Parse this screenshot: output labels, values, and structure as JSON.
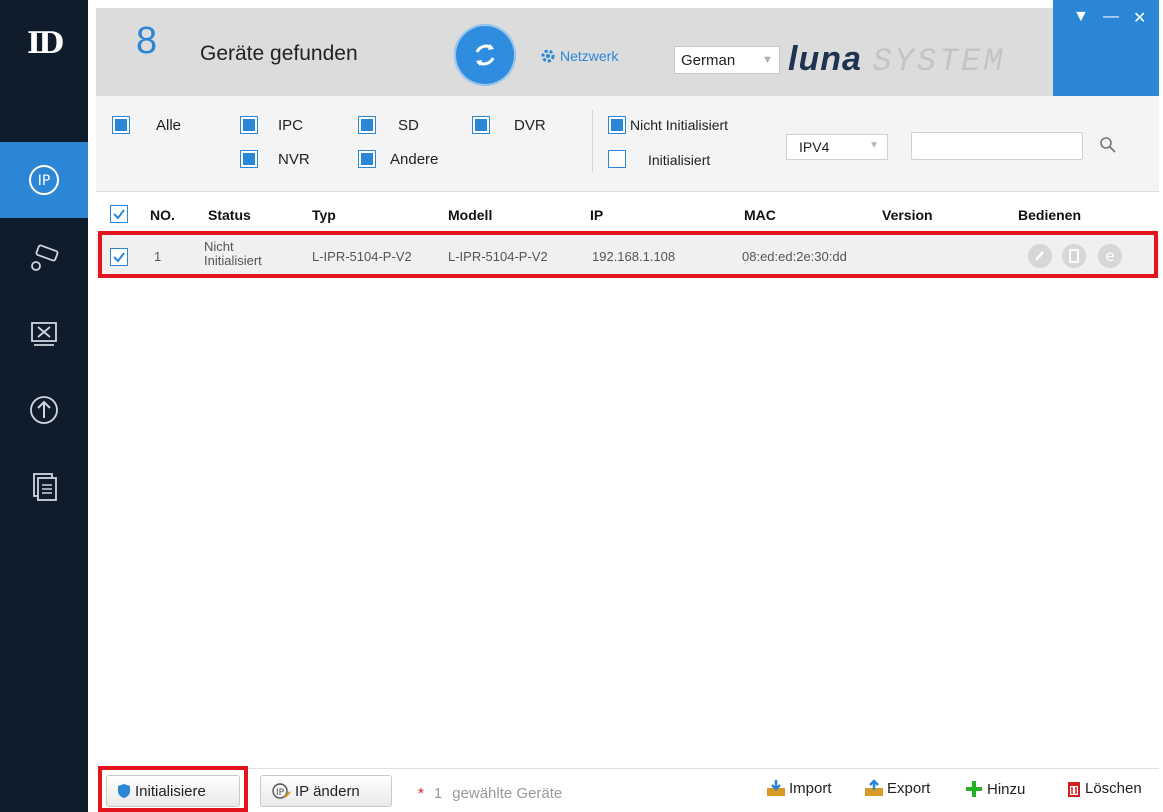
{
  "header": {
    "device_count": "8",
    "found_label": "Geräte gefunden",
    "network_label": "Netzwerk",
    "language": "German",
    "brand_luna": "luna",
    "brand_system": "SYSTEM"
  },
  "filters": {
    "all": "Alle",
    "ipc": "IPC",
    "sd": "SD",
    "dvr": "DVR",
    "nvr": "NVR",
    "other": "Andere",
    "not_initialized": "Nicht Initialisiert",
    "initialized": "Initialisiert",
    "ip_version": "IPV4",
    "search_value": ""
  },
  "table": {
    "headers": [
      "NO.",
      "Status",
      "Typ",
      "Modell",
      "IP",
      "MAC",
      "Version",
      "Bedienen"
    ],
    "rows": [
      {
        "no": "1",
        "status_line1": "Nicht",
        "status_line2": "Initialisiert",
        "type": "L-IPR-5104-P-V2",
        "model": "L-IPR-5104-P-V2",
        "ip": "192.168.1.108",
        "mac": "08:ed:ed:2e:30:dd",
        "version": ""
      }
    ]
  },
  "footer": {
    "initialize_label": "Initialisiere",
    "change_ip_label": "IP ändern",
    "selected_star": "*",
    "selected_count": "1",
    "selected_label": "gewählte Geräte",
    "import_label": "Import",
    "export_label": "Export",
    "add_label": "Hinzu",
    "delete_label": "Löschen"
  },
  "colors": {
    "sidebar": "#0f1c2b",
    "accent": "#2b86d6",
    "highlight": "#e3141e"
  }
}
